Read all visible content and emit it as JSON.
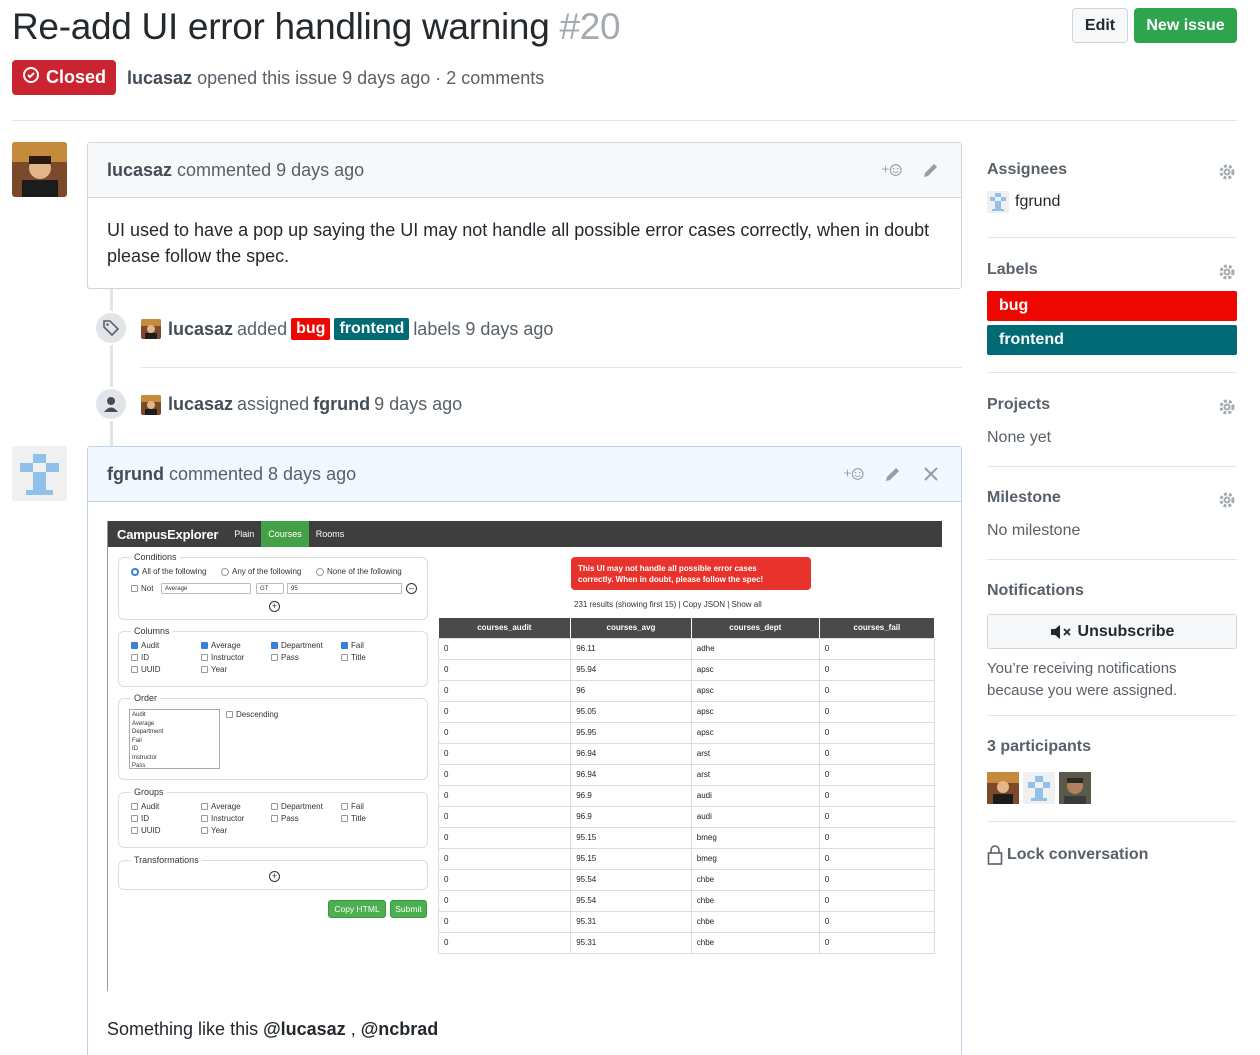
{
  "issue": {
    "title": "Re-add UI error handling warning",
    "number": "#20",
    "state": "Closed",
    "author": "lucasaz",
    "meta_rest": "opened this issue 9 days ago · 2 comments"
  },
  "header": {
    "edit_label": "Edit",
    "new_issue_label": "New issue"
  },
  "comments": [
    {
      "author": "lucasaz",
      "time": "commented 9 days ago",
      "body": "UI used to have a pop up saying the UI may not handle all possible error cases correctly, when in doubt please follow the spec."
    },
    {
      "author": "fgrund",
      "time": "commented 8 days ago",
      "body_prefix": "Something like this",
      "mention1": "@lucasaz",
      "sep": ",",
      "mention2": "@ncbrad"
    }
  ],
  "events": [
    {
      "actor": "lucasaz",
      "action": "added",
      "label1": "bug",
      "label2": "frontend",
      "rest": "labels 9 days ago"
    },
    {
      "actor": "lucasaz",
      "action": "assigned",
      "target": "fgrund",
      "rest": "9 days ago"
    }
  ],
  "sidebar": {
    "assignees_h": "Assignees",
    "assignee": "fgrund",
    "labels_h": "Labels",
    "labels": [
      {
        "name": "bug",
        "color": "#ee0701"
      },
      {
        "name": "frontend",
        "color": "#006b75"
      }
    ],
    "projects_h": "Projects",
    "projects_v": "None yet",
    "milestone_h": "Milestone",
    "milestone_v": "No milestone",
    "notif_h": "Notifications",
    "unsubscribe": "Unsubscribe",
    "notif_text": "You’re receiving notifications because you were assigned.",
    "participants_h": "3 participants",
    "lock": "Lock conversation"
  },
  "screenshot": {
    "brand": "CampusExplorer",
    "nav": [
      "Plain",
      "Courses",
      "Rooms"
    ],
    "conditions": "Conditions",
    "cond_all": "All of the following",
    "cond_any": "Any of the following",
    "cond_none": "None of the following",
    "not": "Not",
    "sel_field": "Average",
    "sel_op": "GT",
    "val": "95",
    "columns": "Columns",
    "col_items": [
      "Audit",
      "ID",
      "UUID",
      "Average",
      "Instructor",
      "Year",
      "Department",
      "Pass",
      "Fail",
      "Title"
    ],
    "order": "Order",
    "order_list": [
      "Audit",
      "Average",
      "Department",
      "Fail",
      "ID",
      "Instructor",
      "Pass"
    ],
    "descending": "Descending",
    "groups": "Groups",
    "transformations": "Transformations",
    "copy_html": "Copy HTML",
    "submit": "Submit",
    "alert1": "This UI may not handle all possible error cases",
    "alert2": "correctly. When in doubt, please follow the spec!",
    "results": "231 results (showing first 15) | Copy JSON | Show all",
    "headers": [
      "courses_audit",
      "courses_avg",
      "courses_dept",
      "courses_fail"
    ],
    "rows": [
      [
        "0",
        "96.11",
        "adhe",
        "0"
      ],
      [
        "0",
        "95.94",
        "apsc",
        "0"
      ],
      [
        "0",
        "96",
        "apsc",
        "0"
      ],
      [
        "0",
        "95.05",
        "apsc",
        "0"
      ],
      [
        "0",
        "95.95",
        "apsc",
        "0"
      ],
      [
        "0",
        "96.94",
        "arst",
        "0"
      ],
      [
        "0",
        "96.94",
        "arst",
        "0"
      ],
      [
        "0",
        "96.9",
        "audi",
        "0"
      ],
      [
        "0",
        "96.9",
        "audi",
        "0"
      ],
      [
        "0",
        "95.15",
        "bmeg",
        "0"
      ],
      [
        "0",
        "95.15",
        "bmeg",
        "0"
      ],
      [
        "0",
        "95.54",
        "chbe",
        "0"
      ],
      [
        "0",
        "95.54",
        "chbe",
        "0"
      ],
      [
        "0",
        "95.31",
        "chbe",
        "0"
      ],
      [
        "0",
        "95.31",
        "chbe",
        "0"
      ]
    ]
  },
  "colors": {
    "closed": "#cb2431",
    "green": "#2ea44f",
    "bug": "#ee0701",
    "frontend": "#006b75"
  }
}
